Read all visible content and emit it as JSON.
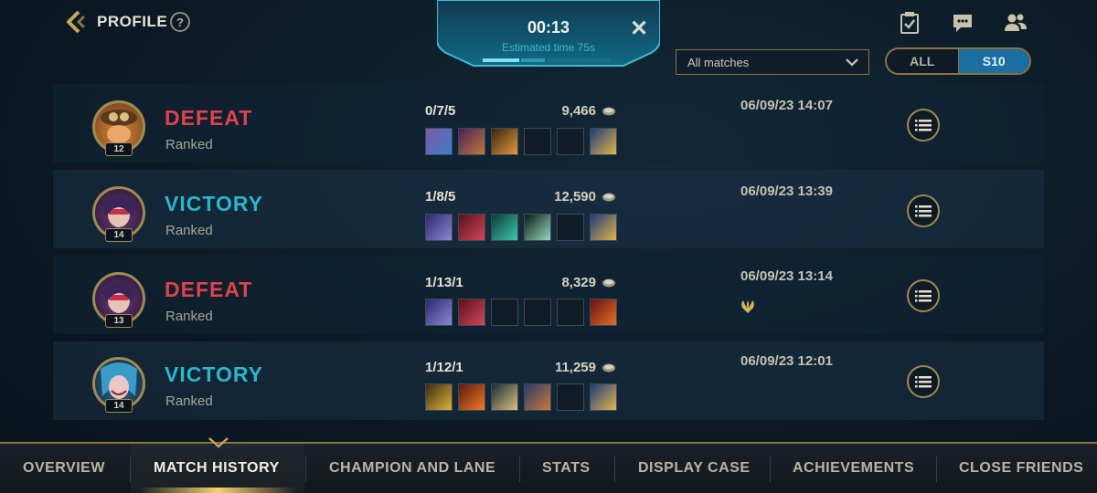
{
  "header": {
    "title": "PROFILE",
    "help_label": "?"
  },
  "queue": {
    "timer": "00:13",
    "estimate": "Estimated time 75s",
    "close_label": "✕"
  },
  "filter": {
    "selected": "All matches",
    "season_options": [
      "ALL",
      "S10"
    ],
    "active_season": "S10"
  },
  "matches": [
    {
      "result": "DEFEAT",
      "queue": "Ranked",
      "level": "12",
      "kda": "0/7/5",
      "gold": "9,466",
      "date": "06/09/23 14:07",
      "champion": "teemo"
    },
    {
      "result": "VICTORY",
      "queue": "Ranked",
      "level": "14",
      "kda": "1/8/5",
      "gold": "12,590",
      "date": "06/09/23 13:39",
      "champion": "vayne"
    },
    {
      "result": "DEFEAT",
      "queue": "Ranked",
      "level": "13",
      "kda": "1/13/1",
      "gold": "8,329",
      "date": "06/09/23 13:14",
      "champion": "vayne"
    },
    {
      "result": "VICTORY",
      "queue": "Ranked",
      "level": "14",
      "kda": "1/12/1",
      "gold": "11,259",
      "date": "06/09/23 12:01",
      "champion": "jinx"
    }
  ],
  "nav": {
    "tabs": [
      "OVERVIEW",
      "MATCH HISTORY",
      "CHAMPION AND LANE",
      "STATS",
      "DISPLAY CASE",
      "ACHIEVEMENTS",
      "CLOSE FRIENDS"
    ],
    "active": "MATCH HISTORY"
  },
  "colors": {
    "defeat": "#e0424c",
    "victory": "#2db5cc",
    "gold_accent": "#a18a52",
    "active_season": "#1b6ea0"
  }
}
